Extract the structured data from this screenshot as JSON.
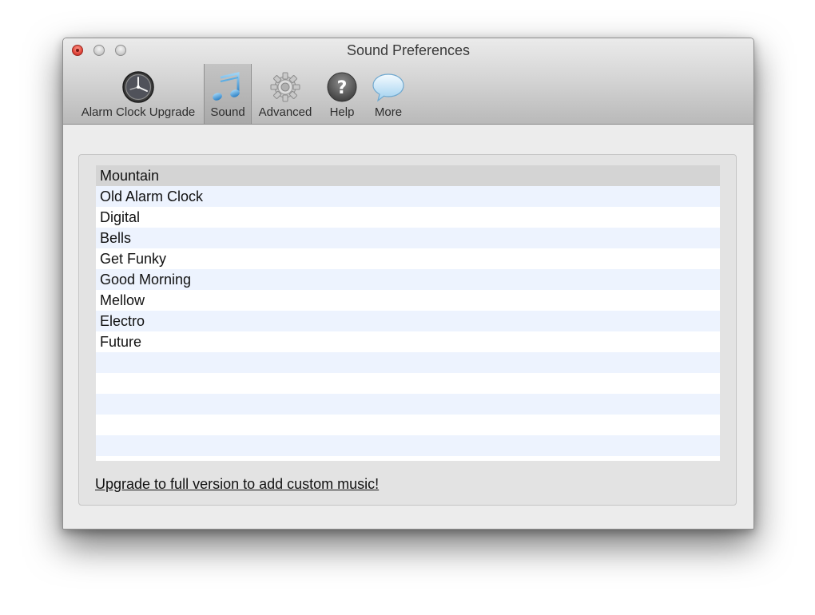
{
  "window": {
    "title": "Sound Preferences"
  },
  "toolbar": {
    "items": [
      {
        "label": "Alarm Clock Upgrade",
        "icon": "clock-icon"
      },
      {
        "label": "Sound",
        "icon": "music-notes-icon",
        "selected": true
      },
      {
        "label": "Advanced",
        "icon": "gear-icon"
      },
      {
        "label": "Help",
        "icon": "help-icon"
      },
      {
        "label": "More",
        "icon": "speech-bubble-icon"
      }
    ]
  },
  "sounds": {
    "selected": "Mountain",
    "items": [
      "Mountain",
      "Old Alarm Clock",
      "Digital",
      "Bells",
      "Get Funky",
      "Good Morning",
      "Mellow",
      "Electro",
      "Future"
    ]
  },
  "upgrade_link": "Upgrade to full version to add custom music!"
}
